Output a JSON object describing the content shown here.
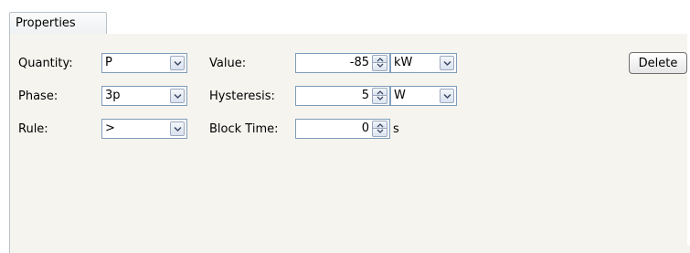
{
  "tab": {
    "label": "Properties"
  },
  "rows": [
    {
      "label": "Quantity:",
      "selected": "P",
      "field_label": "Value:",
      "field_value": "-85",
      "unit": "kW",
      "unit_is_dropdown": true
    },
    {
      "label": "Phase:",
      "selected": "3p",
      "field_label": "Hysteresis:",
      "field_value": "5",
      "unit": "W",
      "unit_is_dropdown": true
    },
    {
      "label": "Rule:",
      "selected": ">",
      "field_label": "Block Time:",
      "field_value": "0",
      "unit": "s",
      "unit_is_dropdown": false
    }
  ],
  "delete_button": {
    "label": "Delete"
  },
  "colors": {
    "panel_bg": "#f5f4ef",
    "input_border": "#7f9db9"
  }
}
